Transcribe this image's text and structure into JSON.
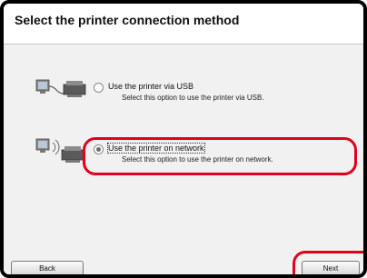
{
  "window": {
    "title": "Select the printer connection method"
  },
  "options": [
    {
      "label": "Use the printer via USB",
      "description": "Select this option to use the printer via USB.",
      "selected": false,
      "icon": "usb-printer-icon"
    },
    {
      "label": "Use the printer on network",
      "description": "Select this option to use the printer on network.",
      "selected": true,
      "icon": "network-printer-icon"
    }
  ],
  "buttons": {
    "back": "Back",
    "next": "Next"
  },
  "colors": {
    "highlight": "#e0001b",
    "background": "#f1f1f1"
  }
}
